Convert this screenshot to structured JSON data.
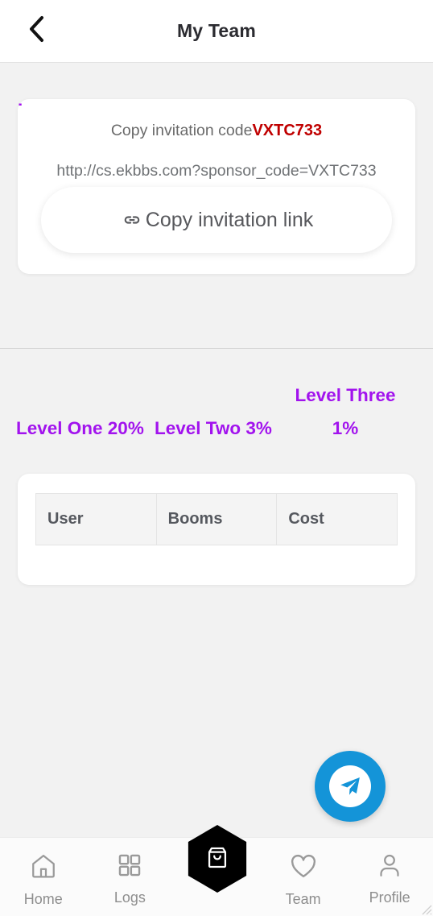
{
  "header": {
    "title": "My Team",
    "back_icon": "chevron-left-icon"
  },
  "invite": {
    "code_label": "Copy invitation code",
    "code": "VXTC733",
    "url": "http://cs.ekbbs.com?sponsor_code=VXTC733",
    "copy_link_label": "Copy invitation link",
    "copy_link_icon": "link-icon"
  },
  "levels": [
    {
      "label": "Level One 20%"
    },
    {
      "label": "Level Two 3%"
    },
    {
      "label": "Level Three 1%"
    },
    {
      "label": "L"
    }
  ],
  "table": {
    "columns": [
      "User",
      "Booms",
      "Cost"
    ],
    "rows": []
  },
  "fab": {
    "icon": "telegram-send-icon"
  },
  "bottom_nav": {
    "items": [
      {
        "label": "Home",
        "icon": "home-icon"
      },
      {
        "label": "Logs",
        "icon": "grid-icon"
      },
      {
        "label": "Team",
        "icon": "heart-icon"
      },
      {
        "label": "Profile",
        "icon": "person-icon"
      }
    ],
    "center_button": {
      "icon": "shopping-bag-icon"
    }
  },
  "colors": {
    "background": "#f2f2f2",
    "card": "#ffffff",
    "accent_purple": "#a213ee",
    "code_red": "#c00000",
    "telegram_blue": "#1494d8",
    "nav_gray": "#8d8d8d",
    "title": "#2b2b30"
  }
}
